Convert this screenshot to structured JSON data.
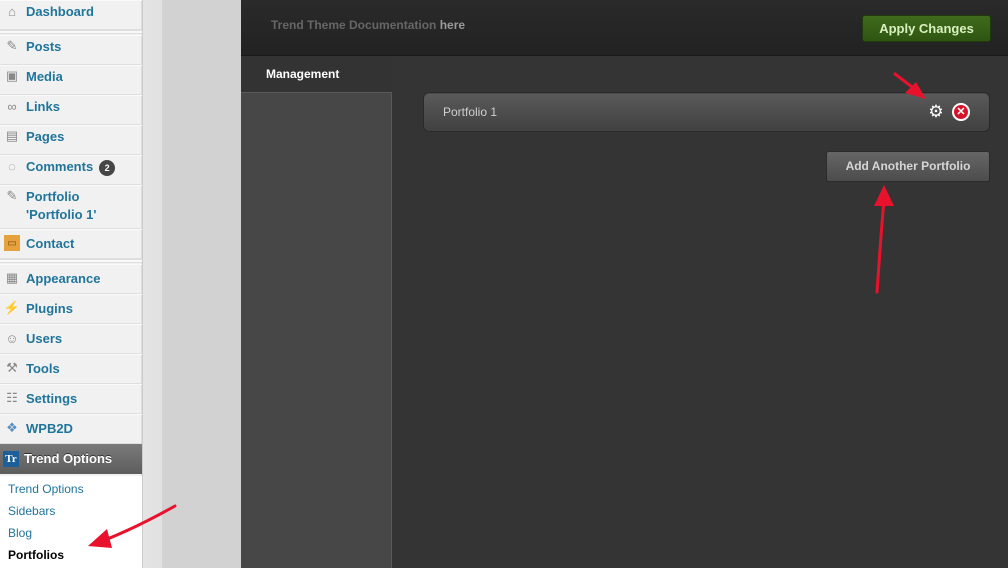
{
  "menu": {
    "items": [
      {
        "label": "Dashboard",
        "icon": "home-icon"
      },
      {
        "label": "Posts",
        "icon": "pin-icon"
      },
      {
        "label": "Media",
        "icon": "media-icon"
      },
      {
        "label": "Links",
        "icon": "link-icon"
      },
      {
        "label": "Pages",
        "icon": "pages-icon"
      },
      {
        "label": "Comments",
        "icon": "comment-icon",
        "badge": "2"
      },
      {
        "label": "Portfolio",
        "label2": "'Portfolio 1'",
        "icon": "pin-icon"
      },
      {
        "label": "Contact",
        "icon": "contact-icon"
      },
      {
        "label": "Appearance",
        "icon": "appearance-icon"
      },
      {
        "label": "Plugins",
        "icon": "plugin-icon"
      },
      {
        "label": "Users",
        "icon": "users-icon"
      },
      {
        "label": "Tools",
        "icon": "tools-icon"
      },
      {
        "label": "Settings",
        "icon": "settings-icon"
      },
      {
        "label": "WPB2D",
        "icon": "wpb2d-icon"
      }
    ],
    "active": {
      "label": "Trend Options",
      "icon_text": "Tr"
    },
    "submenu": [
      "Trend Options",
      "Sidebars",
      "Blog",
      "Portfolios"
    ]
  },
  "topbar": {
    "doc_text": "Trend Theme Documentation",
    "doc_link": "here",
    "apply_label": "Apply Changes"
  },
  "tabs": {
    "management": "Management"
  },
  "portfolios": [
    {
      "name": "Portfolio 1"
    }
  ],
  "add_label": "Add Another Portfolio",
  "colors": {
    "accent_red": "#e8122c",
    "apply_green": "#3f6b1b",
    "link_blue": "#21759b"
  }
}
